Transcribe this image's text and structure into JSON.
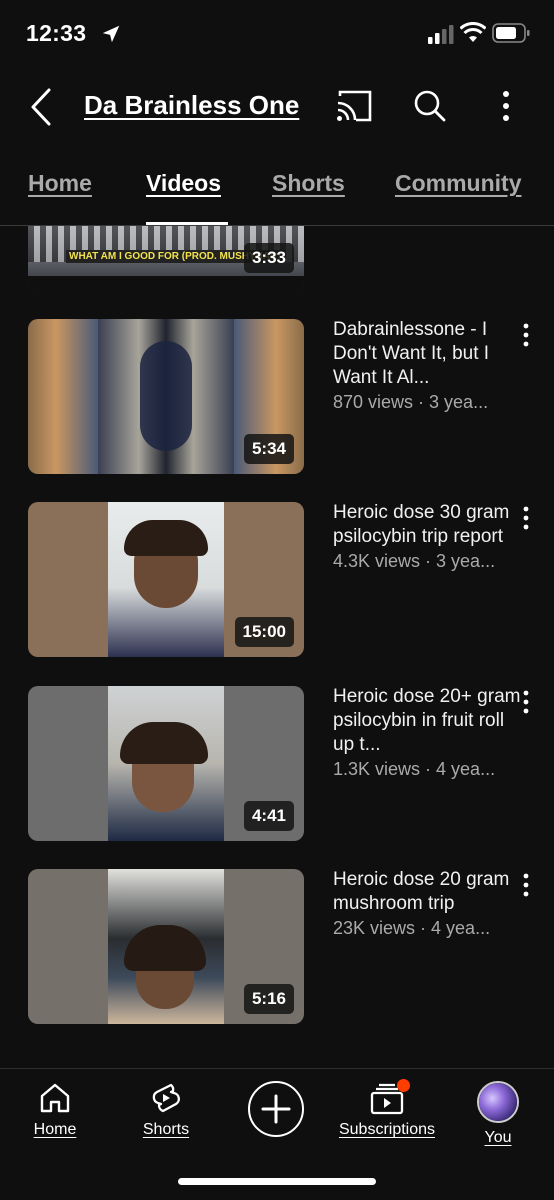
{
  "status_bar": {
    "time": "12:33"
  },
  "header": {
    "channel_name": "Da Brainless One"
  },
  "tabs": [
    {
      "label": "Home",
      "active": false
    },
    {
      "label": "Videos",
      "active": true
    },
    {
      "label": "Shorts",
      "active": false
    },
    {
      "label": "Community",
      "active": false
    }
  ],
  "videos": [
    {
      "thumb_caption": "WHAT AM I GOOD FOR (PROD. MUSHYNAR)",
      "duration": "3:33",
      "title": "",
      "meta": ""
    },
    {
      "title": "Dabrainlessone - I Don't Want It, but I Want It Al...",
      "meta": "870 views · 3 yea...",
      "duration": "5:34"
    },
    {
      "title": "Heroic dose 30 gram psilocybin trip report",
      "meta": "4.3K views · 3 yea...",
      "duration": "15:00"
    },
    {
      "title": "Heroic dose 20+ gram psilocybin in fruit roll up t...",
      "meta": "1.3K views · 4 yea...",
      "duration": "4:41"
    },
    {
      "title": "Heroic dose 20 gram mushroom trip",
      "meta": "23K views · 4 yea...",
      "duration": "5:16"
    }
  ],
  "bottom_nav": {
    "home": "Home",
    "shorts": "Shorts",
    "subscriptions": "Subscriptions",
    "you": "You"
  },
  "colors": {
    "background": "#0f0f0f",
    "text_secondary": "#aaaaaa",
    "notification_dot": "#ff3d00"
  }
}
